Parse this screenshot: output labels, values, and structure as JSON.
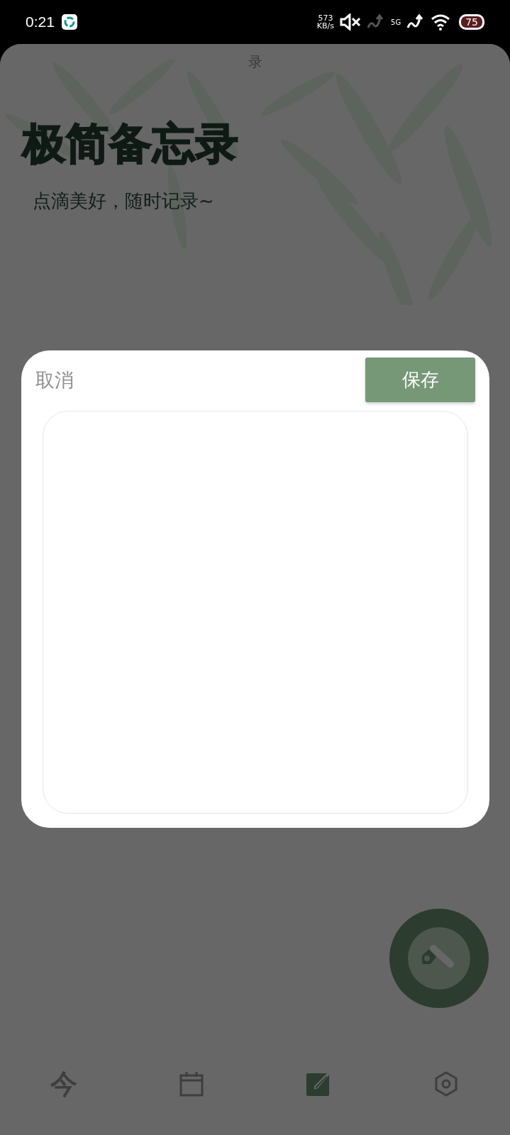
{
  "status_bar": {
    "time": "0:21",
    "speed_value": "573",
    "speed_unit": "KB/s",
    "network": "5G",
    "battery": "75"
  },
  "header": {
    "top_title": "录",
    "title": "极简备忘录",
    "subtitle": "点滴美好，随时记录~"
  },
  "dialog": {
    "cancel": "取消",
    "save": "保存"
  },
  "nav": [
    {
      "kind": "glyph",
      "glyph": "今",
      "selected": false
    },
    {
      "kind": "calendar",
      "selected": false
    },
    {
      "kind": "edit",
      "selected": true
    },
    {
      "kind": "settings",
      "selected": false
    }
  ]
}
